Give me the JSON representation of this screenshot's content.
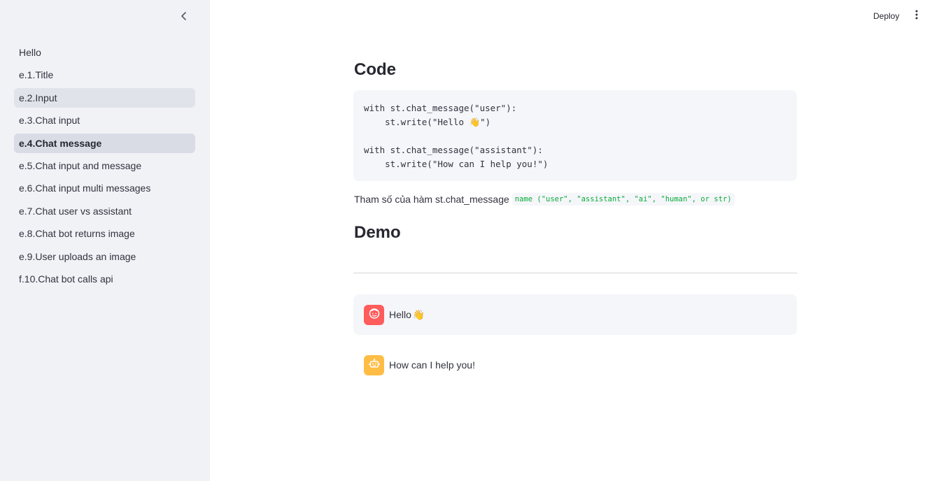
{
  "sidebar": {
    "items": [
      {
        "label": "Hello",
        "state": "normal"
      },
      {
        "label": "e.1.Title",
        "state": "normal"
      },
      {
        "label": "e.2.Input",
        "state": "hover"
      },
      {
        "label": "e.3.Chat input",
        "state": "normal"
      },
      {
        "label": "e.4.Chat message",
        "state": "active"
      },
      {
        "label": "e.5.Chat input and message",
        "state": "normal"
      },
      {
        "label": "e.6.Chat input multi messages",
        "state": "normal"
      },
      {
        "label": "e.7.Chat user vs assistant",
        "state": "normal"
      },
      {
        "label": "e.8.Chat bot returns image",
        "state": "normal"
      },
      {
        "label": "e.9.User uploads an image",
        "state": "normal"
      },
      {
        "label": "f.10.Chat bot calls api",
        "state": "normal"
      }
    ],
    "collapse_icon": "chevron-left-icon"
  },
  "header": {
    "deploy_label": "Deploy",
    "menu_icon": "kebab-menu-icon"
  },
  "main": {
    "code_heading": "Code",
    "code_lines": [
      "with st.chat_message(\"user\"):",
      "    st.write(\"Hello 👋\")",
      "",
      "with st.chat_message(\"assistant\"):",
      "    st.write(\"How can I help you!\")"
    ],
    "param_text": "Tham số của hàm st.chat_message",
    "param_code": "name (\"user\", \"assistant\", \"ai\", \"human\", or str)",
    "demo_heading": "Demo",
    "messages": [
      {
        "role": "user",
        "text": "Hello",
        "emoji": "👋",
        "avatar_icon": "user-face-icon"
      },
      {
        "role": "assistant",
        "text": "How can I help you!",
        "avatar_icon": "robot-icon"
      }
    ]
  },
  "colors": {
    "sidebar_bg": "#f0f2f6",
    "user_avatar": "#ff5c5c",
    "assistant_avatar": "#ffbd45",
    "inline_code": "#09ab3b"
  }
}
